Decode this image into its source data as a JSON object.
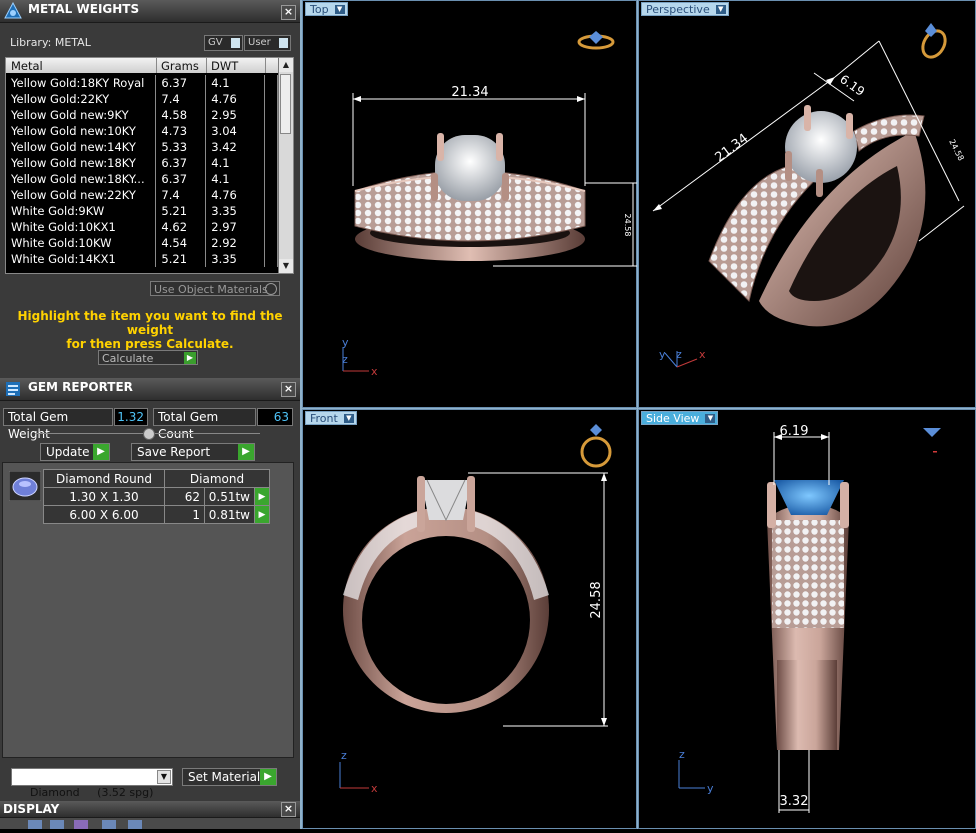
{
  "metal_weights": {
    "title": "METAL WEIGHTS",
    "library_label": "Library: METAL",
    "gv_label": "GV",
    "user_label": "User",
    "columns": [
      "Metal",
      "Grams",
      "DWT"
    ],
    "rows": [
      {
        "metal": "Yellow Gold:18KY Royal",
        "grams": "6.37",
        "dwt": "4.1"
      },
      {
        "metal": "Yellow Gold:22KY",
        "grams": "7.4",
        "dwt": "4.76"
      },
      {
        "metal": "Yellow Gold new:9KY",
        "grams": "4.58",
        "dwt": "2.95"
      },
      {
        "metal": "Yellow Gold new:10KY",
        "grams": "4.73",
        "dwt": "3.04"
      },
      {
        "metal": "Yellow Gold new:14KY",
        "grams": "5.33",
        "dwt": "3.42"
      },
      {
        "metal": "Yellow Gold new:18KY",
        "grams": "6.37",
        "dwt": "4.1"
      },
      {
        "metal": "Yellow Gold new:18KY...",
        "grams": "6.37",
        "dwt": "4.1"
      },
      {
        "metal": "Yellow Gold new:22KY",
        "grams": "7.4",
        "dwt": "4.76"
      },
      {
        "metal": "White Gold:9KW",
        "grams": "5.21",
        "dwt": "3.35"
      },
      {
        "metal": "White Gold:10KX1",
        "grams": "4.62",
        "dwt": "2.97"
      },
      {
        "metal": "White Gold:10KW",
        "grams": "4.54",
        "dwt": "2.92"
      },
      {
        "metal": "White Gold:14KX1",
        "grams": "5.21",
        "dwt": "3.35"
      }
    ],
    "use_object_materials": "Use Object Materials",
    "hint_line1": "Highlight the item you want to find the weight",
    "hint_line2": "for then press Calculate.",
    "calculate_label": "Calculate"
  },
  "gem_reporter": {
    "title": "GEM REPORTER",
    "total_weight_label": "Total Gem Weight",
    "total_weight_value": "1.32",
    "total_count_label": "Total Gem Count",
    "total_count_value": "63",
    "update_label": "Update",
    "save_report_label": "Save Report",
    "header_shape": "Diamond Round",
    "header_material": "Diamond",
    "rows": [
      {
        "size": "1.30 X 1.30",
        "count": "62",
        "weight": "0.51tw"
      },
      {
        "size": "6.00 X 6.00",
        "count": "1",
        "weight": "0.81tw"
      }
    ],
    "material_select": "Diamond     (3.52 spg)",
    "set_material_label": "Set Material"
  },
  "display": {
    "title": "DISPLAY"
  },
  "viewports": {
    "top": {
      "label": "Top",
      "dim_width": "21.34",
      "dim_height": "24.58",
      "axis_y": "y",
      "axis_z": "z",
      "axis_x": "x"
    },
    "perspective": {
      "label": "Perspective",
      "dim_width": "21.34",
      "dim_depth": "6.19",
      "dim_height": "24.58",
      "axis_y": "y",
      "axis_z": "z",
      "axis_x": "x"
    },
    "front": {
      "label": "Front",
      "dim_height": "24.58",
      "axis_z": "z",
      "axis_x": "x"
    },
    "side": {
      "label": "Side View",
      "dim_top": "6.19",
      "dim_bottom": "3.32",
      "axis_z": "z",
      "axis_y": "y"
    }
  },
  "colors": {
    "panel": "#3a3a3a",
    "accent_blue": "#4aaedc",
    "hint_yellow": "#ffd200",
    "ring_metal": "#c9a39a",
    "go_green": "#3aa62e"
  }
}
